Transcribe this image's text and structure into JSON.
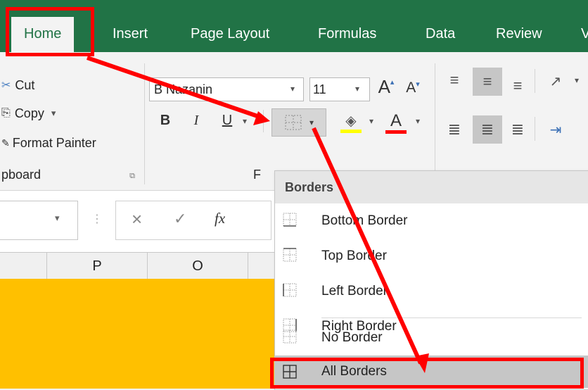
{
  "tabs": [
    "Home",
    "Insert",
    "Page Layout",
    "Formulas",
    "Data",
    "Review",
    "V"
  ],
  "clipboard": {
    "cut": "Cut",
    "copy": "Copy",
    "copy_arrow": "▾",
    "format_painter": "Format Painter",
    "group_label": "pboard"
  },
  "font": {
    "name": "B Nazanin",
    "size": "11",
    "grow": "A",
    "shrink": "A",
    "bold": "B",
    "italic": "I",
    "underline": "U",
    "group_label": "F"
  },
  "formula_bar": {
    "cancel": "×",
    "enter": "✓",
    "fx": "fx"
  },
  "columns": [
    "P",
    "O"
  ],
  "borders_menu": {
    "title": "Borders",
    "items": [
      {
        "label": "Bottom Border",
        "icon": "bottom-border-icon"
      },
      {
        "label": "Top Border",
        "icon": "top-border-icon"
      },
      {
        "label": "Left Border",
        "icon": "left-border-icon"
      },
      {
        "label": "Right Border",
        "icon": "right-border-icon"
      },
      {
        "label": "No Border",
        "icon": "no-border-icon"
      },
      {
        "label": "All Borders",
        "icon": "all-borders-icon",
        "highlighted": true
      }
    ]
  },
  "colors": {
    "ribbon_green": "#217346",
    "cell_fill": "#ffc000",
    "annotation_red": "#ff0000",
    "fill_color_bar": "#ffff00",
    "font_color_bar": "#ff0000"
  }
}
